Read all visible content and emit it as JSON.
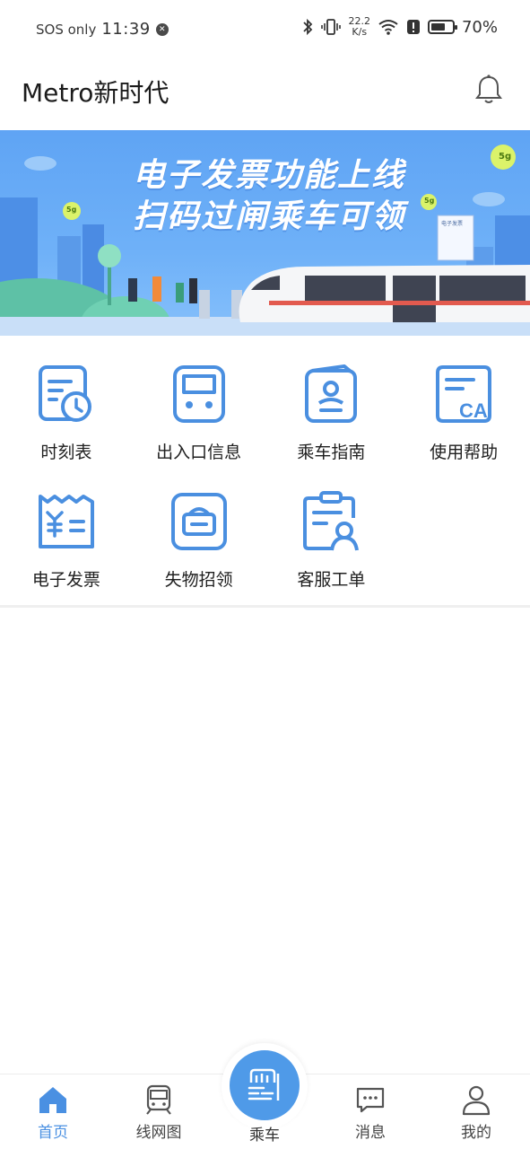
{
  "status_bar": {
    "carrier": "SOS only",
    "time": "11:39",
    "net_rate_value": "22.2",
    "net_rate_unit": "K/s",
    "battery": "70%",
    "battery_level": 0.7
  },
  "header": {
    "title": "Metro新时代",
    "bell_icon": "bell-icon"
  },
  "banner": {
    "line1": "电子发票功能上线",
    "line2": "扫码过闸乘车可领",
    "badge": "5g",
    "receipt_title": "电子发票"
  },
  "services": [
    {
      "label": "时刻表",
      "icon": "timetable-icon"
    },
    {
      "label": "出入口信息",
      "icon": "entrance-icon"
    },
    {
      "label": "乘车指南",
      "icon": "guide-icon"
    },
    {
      "label": "使用帮助",
      "icon": "help-icon"
    },
    {
      "label": "电子发票",
      "icon": "invoice-icon"
    },
    {
      "label": "失物招领",
      "icon": "lost-found-icon"
    },
    {
      "label": "客服工单",
      "icon": "service-ticket-icon"
    }
  ],
  "bottom_nav": {
    "home": "首页",
    "network": "线网图",
    "ride": "乘车",
    "messages": "消息",
    "mine": "我的"
  },
  "colors": {
    "accent": "#4a90e2",
    "icon_blue": "#4a8fe0",
    "banner_bg": "#6fb1f8"
  }
}
